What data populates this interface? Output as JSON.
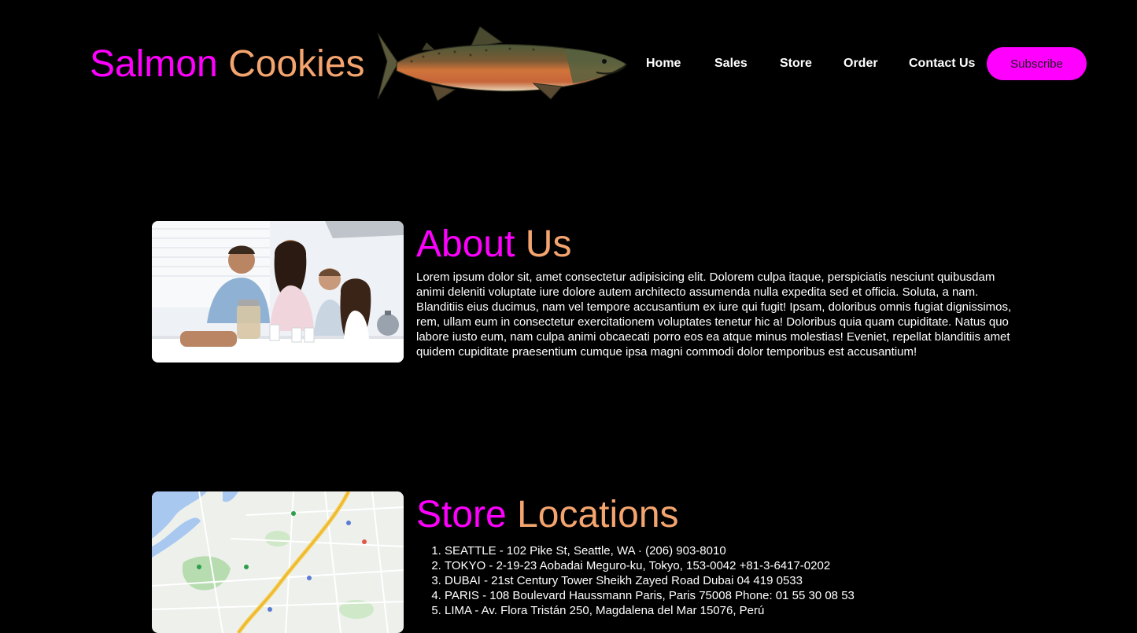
{
  "brand": {
    "word1": "Salmon",
    "word2": "Cookies"
  },
  "nav": {
    "home": "Home",
    "sales": "Sales",
    "store": "Store",
    "order": "Order",
    "contact": "Contact Us"
  },
  "subscribe_label": "Subscribe",
  "about": {
    "title_word1": "About",
    "title_word2": "Us",
    "text": "Lorem ipsum dolor sit, amet consectetur adipisicing elit. Dolorem culpa itaque, perspiciatis nesciunt quibusdam animi deleniti voluptate iure dolore autem architecto assumenda nulla expedita sed et officia. Soluta, a nam. Blanditiis eius ducimus, nam vel tempore accusantium ex iure qui fugit! Ipsam, doloribus omnis fugiat dignissimos, rem, ullam eum in consectetur exercitationem voluptates tenetur hic a! Doloribus quia quam cupiditate. Natus quo labore iusto eum, nam culpa animi obcaecati porro eos ea atque minus molestias! Eveniet, repellat blanditiis amet quidem cupiditate praesentium cumque ipsa magni commodi dolor temporibus est accusantium!"
  },
  "locations": {
    "title_word1": "Store",
    "title_word2": "Locations",
    "items": [
      "SEATTLE - 102 Pike St, Seattle, WA · (206) 903-8010",
      "TOKYO - 2-19-23 Aobadai Meguro-ku, Tokyo, 153-0042 +81-3-6417-0202",
      "DUBAI - 21st Century Tower Sheikh Zayed Road Dubai 04 419 0533",
      "PARIS - 108 Boulevard Haussmann Paris, Paris 75008 Phone: 01 55 30 08 53",
      "LIMA - Av. Flora Tristán 250, Magdalena del Mar 15076, Perú"
    ]
  },
  "colors": {
    "background": "#000000",
    "accent_magenta": "#ff00ff",
    "accent_peach": "#f4a46e"
  },
  "icons": {
    "logo_image": "salmon-fish-image",
    "about_image": "family-kitchen-photo",
    "locations_image": "map-image"
  }
}
